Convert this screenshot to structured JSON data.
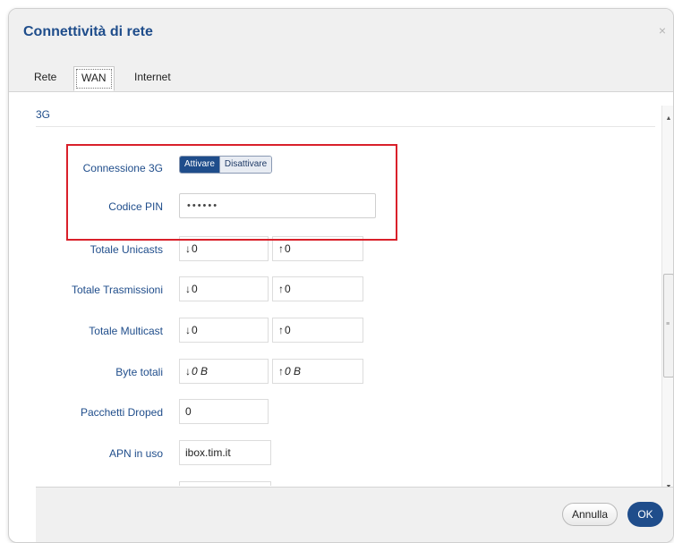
{
  "dialog": {
    "title": "Connettività di rete",
    "close_icon": "×"
  },
  "tabs": [
    {
      "label": "Rete",
      "active": false
    },
    {
      "label": "WAN",
      "active": true
    },
    {
      "label": "Internet",
      "active": false
    }
  ],
  "section": {
    "title": "3G"
  },
  "connection": {
    "label": "Connessione 3G",
    "on_label": "Attivare",
    "off_label": "Disattivare",
    "selected": "Attivare"
  },
  "pin": {
    "label": "Codice PIN",
    "value": "••••••"
  },
  "stats": [
    {
      "label": "Totale Unicasts",
      "down": "0",
      "up": "0"
    },
    {
      "label": "Totale Trasmissioni",
      "down": "0",
      "up": "0"
    },
    {
      "label": "Totale Multicast",
      "down": "0",
      "up": "0"
    },
    {
      "label": "Byte totali",
      "down": "0 B",
      "up": "0 B"
    }
  ],
  "dropped": {
    "label": "Pacchetti Droped",
    "value": "0"
  },
  "apn": {
    "label": "APN in uso",
    "value": "ibox.tim.it"
  },
  "icons": {
    "down_arrow": "↓",
    "up_arrow": "↑",
    "scroll_up": "▲",
    "scroll_down": "▼",
    "grip": "≡"
  },
  "footer": {
    "cancel_label": "Annulla",
    "ok_label": "OK"
  },
  "colors": {
    "accent": "#1f4d8b",
    "highlight": "#d9202a"
  }
}
